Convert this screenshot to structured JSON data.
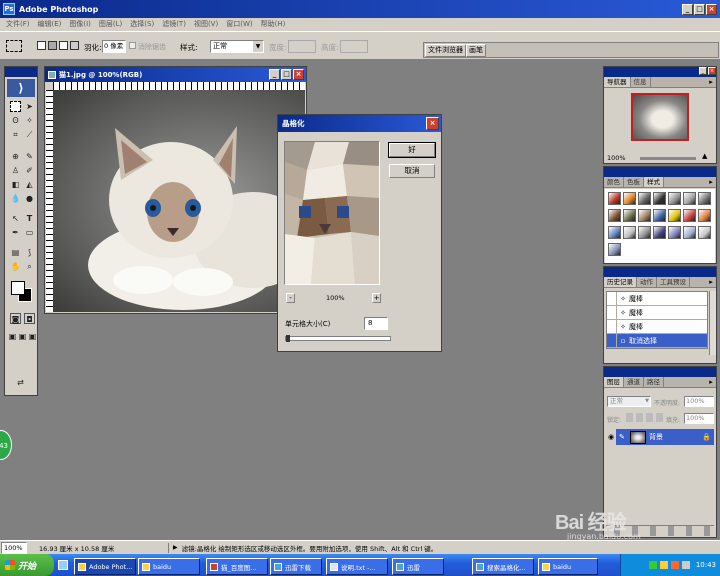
{
  "app": {
    "title": "Adobe Photoshop"
  },
  "menu": {
    "items": [
      "文件(F)",
      "编辑(E)",
      "图像(I)",
      "图层(L)",
      "选择(S)",
      "滤镜(T)",
      "视图(V)",
      "窗口(W)",
      "帮助(H)"
    ]
  },
  "options": {
    "feather_label": "羽化:",
    "feather_value": "0 像素",
    "antialias_label": "消除锯齿",
    "style_label": "样式:",
    "style_value": "正常",
    "width_label": "宽度:",
    "height_label": "高度:",
    "tab_file_browser": "文件浏览器",
    "tab_brushes": "画笔"
  },
  "document": {
    "title": "猫1.jpg @ 100%(RGB)"
  },
  "dialog": {
    "title": "晶格化",
    "ok_label": "好",
    "cancel_label": "取消",
    "zoom": "100%",
    "zoom_minus": "-",
    "zoom_plus": "+",
    "cell_size_label": "单元格大小(C)",
    "cell_size_value": "8"
  },
  "navigator": {
    "tabs": [
      "导航器",
      "信息"
    ],
    "zoom": "100%"
  },
  "swatches": {
    "tabs": [
      "颜色",
      "色板",
      "样式"
    ],
    "colors": [
      "#c03020",
      "#e08020",
      "#606060",
      "#303030",
      "#909090",
      "#a0a0a0",
      "#707070",
      "#805030",
      "#6a6a4a",
      "#a08060",
      "#4060a0",
      "#e0c000",
      "#c04040",
      "#e08040",
      "#6080c0",
      "#c0c0c0",
      "#909090",
      "#404080",
      "#8080c0",
      "#a0b0d0",
      "#c8c8c8",
      "#8090b0"
    ]
  },
  "history": {
    "tabs": [
      "历史记录",
      "动作",
      "工具预设"
    ],
    "items": [
      {
        "label": "魔棒"
      },
      {
        "label": "魔棒"
      },
      {
        "label": "魔棒"
      },
      {
        "label": "取消选择"
      }
    ]
  },
  "layers": {
    "tabs": [
      "图层",
      "通道",
      "路径"
    ],
    "blend_mode": "正常",
    "opacity_label": "不透明度:",
    "opacity_value": "100%",
    "lock_label": "锁定:",
    "fill_label": "填充:",
    "fill_value": "100%",
    "layer_name": "背景"
  },
  "status": {
    "zoom": "100%",
    "doc_size": "16.93 厘米 x 10.58 厘米",
    "hint": "滤镜:晶格化  绘制矩形选区或移动选区外框。要用附加选项，使用 Shift、Alt 和 Ctrl 键。"
  },
  "watermark": {
    "brand": "Bai 经验",
    "url": "jingyan.baidu.com"
  },
  "taskbar": {
    "start_label": "开始",
    "tasks": [
      "Adobe Phot...",
      "baidu",
      "猫_百度图...",
      "迅雷下载",
      "说明.txt -...",
      "迅雷",
      "搜索晶格化...",
      "baidu"
    ],
    "clock": "10:43"
  },
  "side_badge": "43",
  "colors": {
    "title_blue": "#0a2a8a",
    "highlight": "#3a60c8",
    "taskbar": "#245edb",
    "start_green": "#3a9a30"
  }
}
